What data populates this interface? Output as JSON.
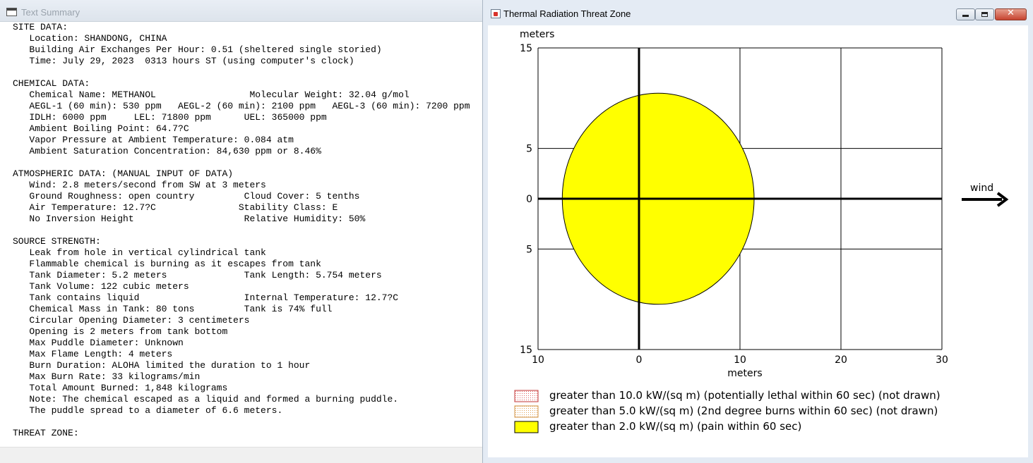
{
  "left_window": {
    "title": "Text Summary",
    "summary_text": "SITE DATA:\n   Location: SHANDONG, CHINA\n   Building Air Exchanges Per Hour: 0.51 (sheltered single storied)\n   Time: July 29, 2023  0313 hours ST (using computer's clock)\n\nCHEMICAL DATA:\n   Chemical Name: METHANOL                 Molecular Weight: 32.04 g/mol\n   AEGL-1 (60 min): 530 ppm   AEGL-2 (60 min): 2100 ppm   AEGL-3 (60 min): 7200 ppm\n   IDLH: 6000 ppm     LEL: 71800 ppm      UEL: 365000 ppm\n   Ambient Boiling Point: 64.7?C\n   Vapor Pressure at Ambient Temperature: 0.084 atm\n   Ambient Saturation Concentration: 84,630 ppm or 8.46%\n\nATMOSPHERIC DATA: (MANUAL INPUT OF DATA)\n   Wind: 2.8 meters/second from SW at 3 meters\n   Ground Roughness: open country         Cloud Cover: 5 tenths\n   Air Temperature: 12.7?C               Stability Class: E\n   No Inversion Height                    Relative Humidity: 50%\n\nSOURCE STRENGTH:\n   Leak from hole in vertical cylindrical tank\n   Flammable chemical is burning as it escapes from tank\n   Tank Diameter: 5.2 meters              Tank Length: 5.754 meters\n   Tank Volume: 122 cubic meters\n   Tank contains liquid                   Internal Temperature: 12.7?C\n   Chemical Mass in Tank: 80 tons         Tank is 74% full\n   Circular Opening Diameter: 3 centimeters\n   Opening is 2 meters from tank bottom\n   Max Puddle Diameter: Unknown\n   Max Flame Length: 4 meters\n   Burn Duration: ALOHA limited the duration to 1 hour\n   Max Burn Rate: 33 kilograms/min\n   Total Amount Burned: 1,848 kilograms\n   Note: The chemical escaped as a liquid and formed a burning puddle.\n   The puddle spread to a diameter of 6.6 meters.\n\nTHREAT ZONE:"
  },
  "right_window": {
    "title": "Thermal Radiation Threat Zone",
    "close_glyph": "✕",
    "wind_label": "wind",
    "colors": {
      "pain_zone": "#ffff00",
      "lethal_legend": "#f4b6b6",
      "burns_legend": "#f7ddb2",
      "axis": "#000000"
    }
  },
  "chart_data": {
    "type": "area",
    "xlabel": "meters",
    "ylabel": "meters",
    "x_ticks": [
      "10",
      "0",
      "10",
      "20",
      "30"
    ],
    "y_ticks": [
      "15",
      "5",
      "0",
      "5",
      "15"
    ],
    "xlim": [
      -10,
      30
    ],
    "ylim": [
      -15,
      15
    ],
    "grid": true,
    "legend": [
      {
        "label": "greater than 10.0 kW/(sq m) (potentially lethal within 60 sec) (not drawn)"
      },
      {
        "label": "greater than 5.0 kW/(sq m) (2nd degree burns within 60 sec) (not drawn)"
      },
      {
        "label": "greater than 2.0 kW/(sq m) (pain within 60 sec)"
      }
    ],
    "zones": [
      {
        "name": "pain",
        "center_x": 1.9,
        "center_y": 0,
        "radius_x": 9.5,
        "radius_y": 10.5
      }
    ]
  }
}
